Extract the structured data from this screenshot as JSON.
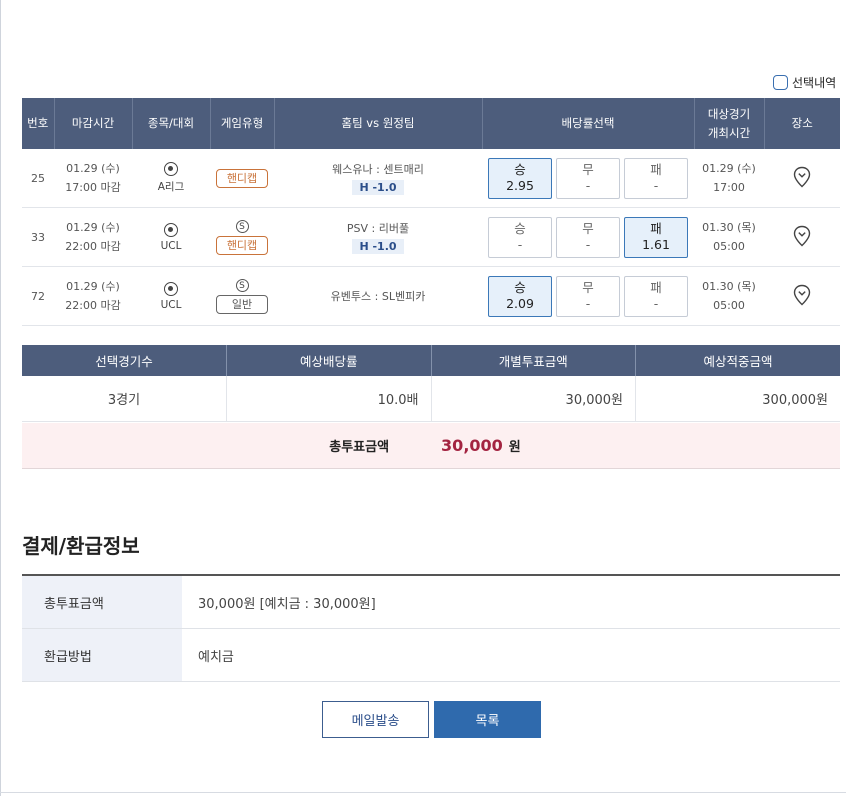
{
  "selection_toggle": {
    "label": "선택내역"
  },
  "match_table": {
    "headers": {
      "no": "번호",
      "deadline": "마감시간",
      "league": "종목/대회",
      "game_type": "게임유형",
      "teams": "홈팀 vs 원정팀",
      "odds": "배당률선택",
      "match_time_1": "대상경기",
      "match_time_2": "개최시간",
      "venue": "장소"
    },
    "rows": [
      {
        "no": "25",
        "deadline_date": "01.29 (수)",
        "deadline_time": "17:00 마감",
        "league": "A리그",
        "type_badge": "",
        "type_label": "핸디캡",
        "teams": "웨스유나 : 센트매리",
        "handicap": "H -1.0",
        "odds": [
          {
            "label": "승",
            "value": "2.95",
            "selected": true
          },
          {
            "label": "무",
            "value": "-",
            "selected": false
          },
          {
            "label": "패",
            "value": "-",
            "selected": false
          }
        ],
        "match_date": "01.29 (수)",
        "match_time": "17:00"
      },
      {
        "no": "33",
        "deadline_date": "01.29 (수)",
        "deadline_time": "22:00 마감",
        "league": "UCL",
        "type_badge": "S",
        "type_label": "핸디캡",
        "teams": "PSV : 리버풀",
        "handicap": "H -1.0",
        "odds": [
          {
            "label": "승",
            "value": "-",
            "selected": false
          },
          {
            "label": "무",
            "value": "-",
            "selected": false
          },
          {
            "label": "패",
            "value": "1.61",
            "selected": true
          }
        ],
        "match_date": "01.30 (목)",
        "match_time": "05:00"
      },
      {
        "no": "72",
        "deadline_date": "01.29 (수)",
        "deadline_time": "22:00 마감",
        "league": "UCL",
        "type_badge": "S",
        "type_label": "일반",
        "teams": "유벤투스 : SL벤피카",
        "handicap": "",
        "odds": [
          {
            "label": "승",
            "value": "2.09",
            "selected": true
          },
          {
            "label": "무",
            "value": "-",
            "selected": false
          },
          {
            "label": "패",
            "value": "-",
            "selected": false
          }
        ],
        "match_date": "01.30 (목)",
        "match_time": "05:00"
      }
    ]
  },
  "summary": {
    "headers": [
      "선택경기수",
      "예상배당률",
      "개별투표금액",
      "예상적중금액"
    ],
    "values": [
      "3경기",
      "10.0배",
      "30,000원",
      "300,000원"
    ],
    "total_label": "총투표금액",
    "total_value": "30,000",
    "total_unit": "원"
  },
  "payment": {
    "title": "결제/환급정보",
    "rows": [
      {
        "label": "총투표금액",
        "value": "30,000원 [예치금 : 30,000원]"
      },
      {
        "label": "환급방법",
        "value": "예치금"
      }
    ]
  },
  "buttons": {
    "email": "메일발송",
    "list": "목록"
  },
  "colors": {
    "header_bg": "#4d5d7c",
    "accent": "#2f6aad",
    "total": "#a32441",
    "handicap": "#c9733a"
  }
}
